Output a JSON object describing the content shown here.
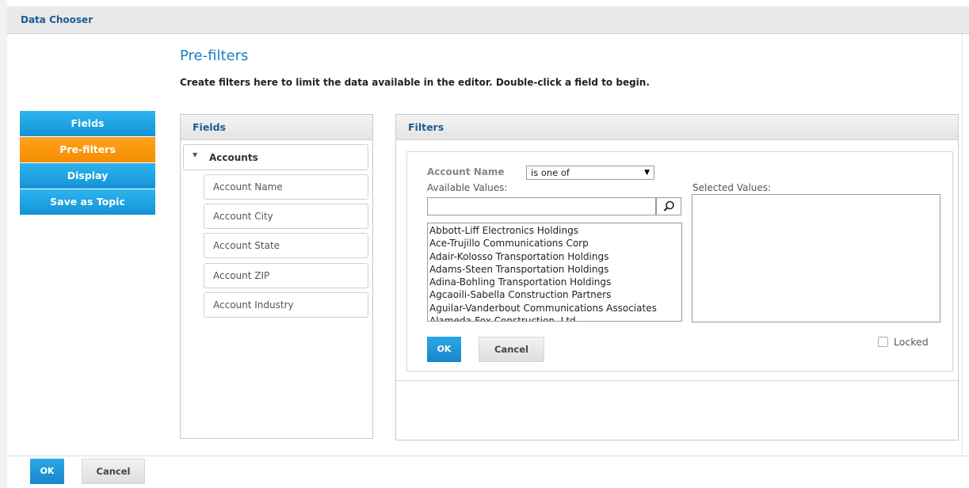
{
  "window": {
    "title": "Data Chooser"
  },
  "page": {
    "title": "Pre-filters",
    "description": "Create filters here to limit the data available in the editor. Double-click a field to begin."
  },
  "nav": {
    "items": [
      {
        "label": "Fields",
        "active": false
      },
      {
        "label": "Pre-filters",
        "active": true
      },
      {
        "label": "Display",
        "active": false
      },
      {
        "label": "Save as Topic",
        "active": false
      }
    ]
  },
  "fields_panel": {
    "title": "Fields",
    "group": "Accounts",
    "items": [
      "Account Name",
      "Account City",
      "Account State",
      "Account ZIP",
      "Account Industry"
    ]
  },
  "filters_panel": {
    "title": "Filters",
    "field_label": "Account Name",
    "operator": "is one of",
    "available_label": "Available Values:",
    "selected_label": "Selected Values:",
    "search_value": "",
    "available_values": [
      "Abbott-Liff Electronics Holdings",
      "Ace-Trujillo Communications Corp",
      "Adair-Kolosso Transportation Holdings",
      "Adams-Steen Transportation Holdings",
      "Adina-Bohling Transportation Holdings",
      "Agcaoili-Sabella Construction Partners",
      "Aguilar-Vanderbout Communications Associates",
      "Alameda-Fox Construction, Ltd"
    ],
    "ok_label": "OK",
    "cancel_label": "Cancel",
    "locked_label": "Locked",
    "locked": false
  },
  "footer": {
    "ok_label": "OK",
    "cancel_label": "Cancel"
  },
  "colors": {
    "accent_blue": "#1d8fd6",
    "active_orange": "#f79510",
    "title_blue": "#1b5c93"
  },
  "icons": {
    "tree_caret": "triangle-down-icon",
    "search": "search-icon",
    "select_arrow": "dropdown-arrow-icon"
  }
}
